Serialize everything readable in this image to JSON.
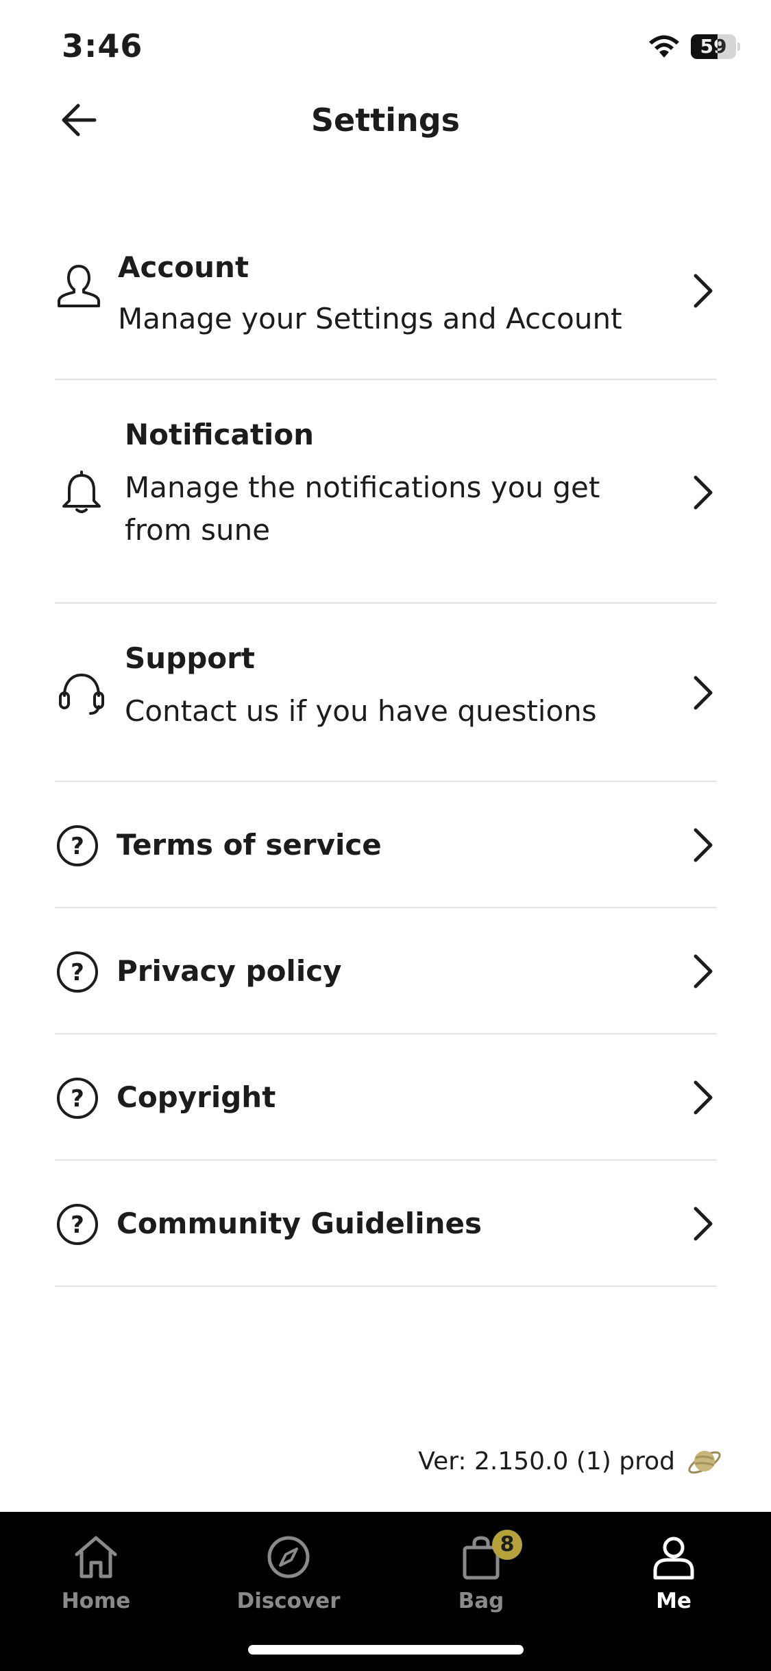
{
  "status_bar": {
    "time": "3:46",
    "battery": "59",
    "battery_level": 0.59
  },
  "header": {
    "title": "Settings"
  },
  "settings": [
    {
      "title": "Account",
      "subtitle": "Manage your Settings and Account",
      "icon": "user-icon"
    },
    {
      "title": "Notification",
      "subtitle": "Manage the notifications you get from sune",
      "icon": "bell-icon"
    },
    {
      "title": "Support",
      "subtitle": "Contact us if you have questions",
      "icon": "headphones-icon"
    },
    {
      "title": "Terms of service",
      "icon": "help-circle-icon"
    },
    {
      "title": "Privacy policy",
      "icon": "help-circle-icon"
    },
    {
      "title": "Copyright",
      "icon": "help-circle-icon"
    },
    {
      "title": "Community Guidelines",
      "icon": "help-circle-icon"
    }
  ],
  "footer": {
    "version": "Ver: 2.150.0 (1) prod"
  },
  "tab_bar": {
    "tabs": [
      {
        "label": "Home",
        "icon": "home-icon",
        "active": false
      },
      {
        "label": "Discover",
        "icon": "compass-icon",
        "active": false
      },
      {
        "label": "Bag",
        "icon": "bag-icon",
        "active": false,
        "badge": "8"
      },
      {
        "label": "Me",
        "icon": "person-icon",
        "active": true
      }
    ]
  },
  "colors": {
    "tab_bar_bg": "#000000",
    "badge": "#b6a23a",
    "divider": "#e2e2e2"
  }
}
